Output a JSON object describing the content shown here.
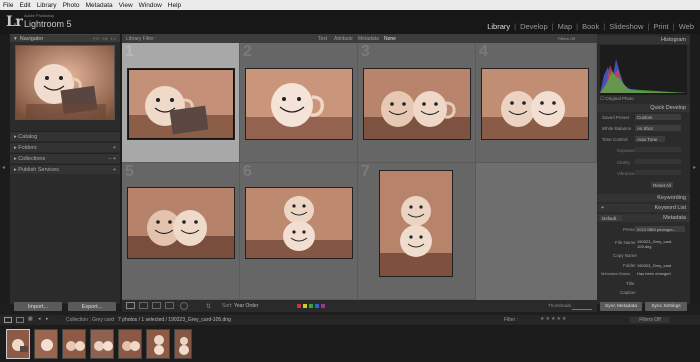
{
  "menubar": [
    "File",
    "Edit",
    "Library",
    "Photo",
    "Metadata",
    "View",
    "Window",
    "Help"
  ],
  "identity": {
    "logo": "Lr",
    "small": "Adobe Photoshop",
    "product": "Lightroom 5"
  },
  "modules": [
    "Library",
    "Develop",
    "Map",
    "Book",
    "Slideshow",
    "Print",
    "Web"
  ],
  "active_module": "Library",
  "left": {
    "navigator": "Navigator",
    "nav_modes": [
      "FIT",
      "Fill",
      "1:1"
    ],
    "items": [
      "Catalog",
      "Folders",
      "Collections",
      "Publish Services"
    ],
    "import": "Import...",
    "export": "Export..."
  },
  "filter": {
    "title": "Library Filter :",
    "options": [
      "Text",
      "Attribute",
      "Metadata",
      "None"
    ],
    "preset": "Filters Off"
  },
  "grid": {
    "numbers": [
      "1",
      "2",
      "3",
      "4",
      "5",
      "6",
      "7"
    ]
  },
  "toolbar": {
    "sort_label": "Sort:",
    "sort_value": "Year Order",
    "thumbnails": "Thumbnails"
  },
  "right": {
    "histogram": "Histogram",
    "original_photo": "Original Photo",
    "quick_develop": "Quick Develop",
    "saved_preset_label": "Saved Preset",
    "saved_preset_value": "Custom",
    "white_balance_label": "White Balance",
    "white_balance_value": "As Shot",
    "tone_control_label": "Tone Control",
    "tone_control_value": "Auto Tone",
    "exposure": "Exposure",
    "clarity": "Clarity",
    "vibrance": "Vibrance",
    "reset_all": "Reset All",
    "keywording": "Keywording",
    "keyword_list": "Keyword List",
    "metadata": "Metadata",
    "meta_preset": "Default",
    "preset_label": "Preset",
    "preset_value": "2019 SBM photogra...",
    "file_name_label": "File Name",
    "file_name_value": "190323_Grey_card-105.dng",
    "copy_name_label": "Copy Name",
    "folder_label": "Folder",
    "folder_value": "190323_Grey_card",
    "metadata_status_label": "Metadata Status",
    "metadata_status_value": "Has been changed",
    "title_label": "Title",
    "caption_label": "Caption",
    "sync_metadata": "Sync Metadata",
    "sync_settings": "Sync Settings"
  },
  "filmbar": {
    "pages": [
      "1",
      "2"
    ],
    "collection": "Collection : Grey card",
    "count": "7 photos / 1 selected / 190323_Grey_card-105.dng",
    "filter_label": "Filter :",
    "filter_value": "Filters Off"
  },
  "colors": {
    "accent": "#e0e0e0",
    "selection": "#a8a8a8",
    "grid_bg": "#6e6e6e"
  }
}
